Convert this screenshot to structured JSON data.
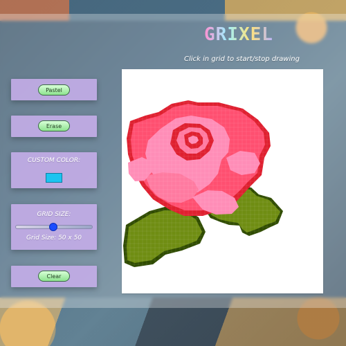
{
  "app": {
    "title": "GRIXEL",
    "instructions": "Click in grid to start/stop drawing"
  },
  "controls": {
    "pastel_button": "Pastel",
    "erase_button": "Erase",
    "custom_color_label": "CUSTOM COLOR:",
    "custom_color_value": "#1bc4f0",
    "grid_size_label": "GRID SIZE:",
    "grid_size_text": "Grid Size: 50 x 50",
    "grid_size_value": 50,
    "clear_button": "Clear"
  },
  "colors": {
    "panel": "#c4ade8",
    "pill": "#8ee38f",
    "rose_dark": "#df1f2f",
    "rose_mid": "#ff4f70",
    "rose_light": "#ff7aa0",
    "rose_pink": "#ff8db7",
    "leaf_dark": "#556f00",
    "leaf_light": "#6f8d12",
    "leaf_outline": "#2f4b00",
    "canvas_bg": "#ffffff"
  }
}
